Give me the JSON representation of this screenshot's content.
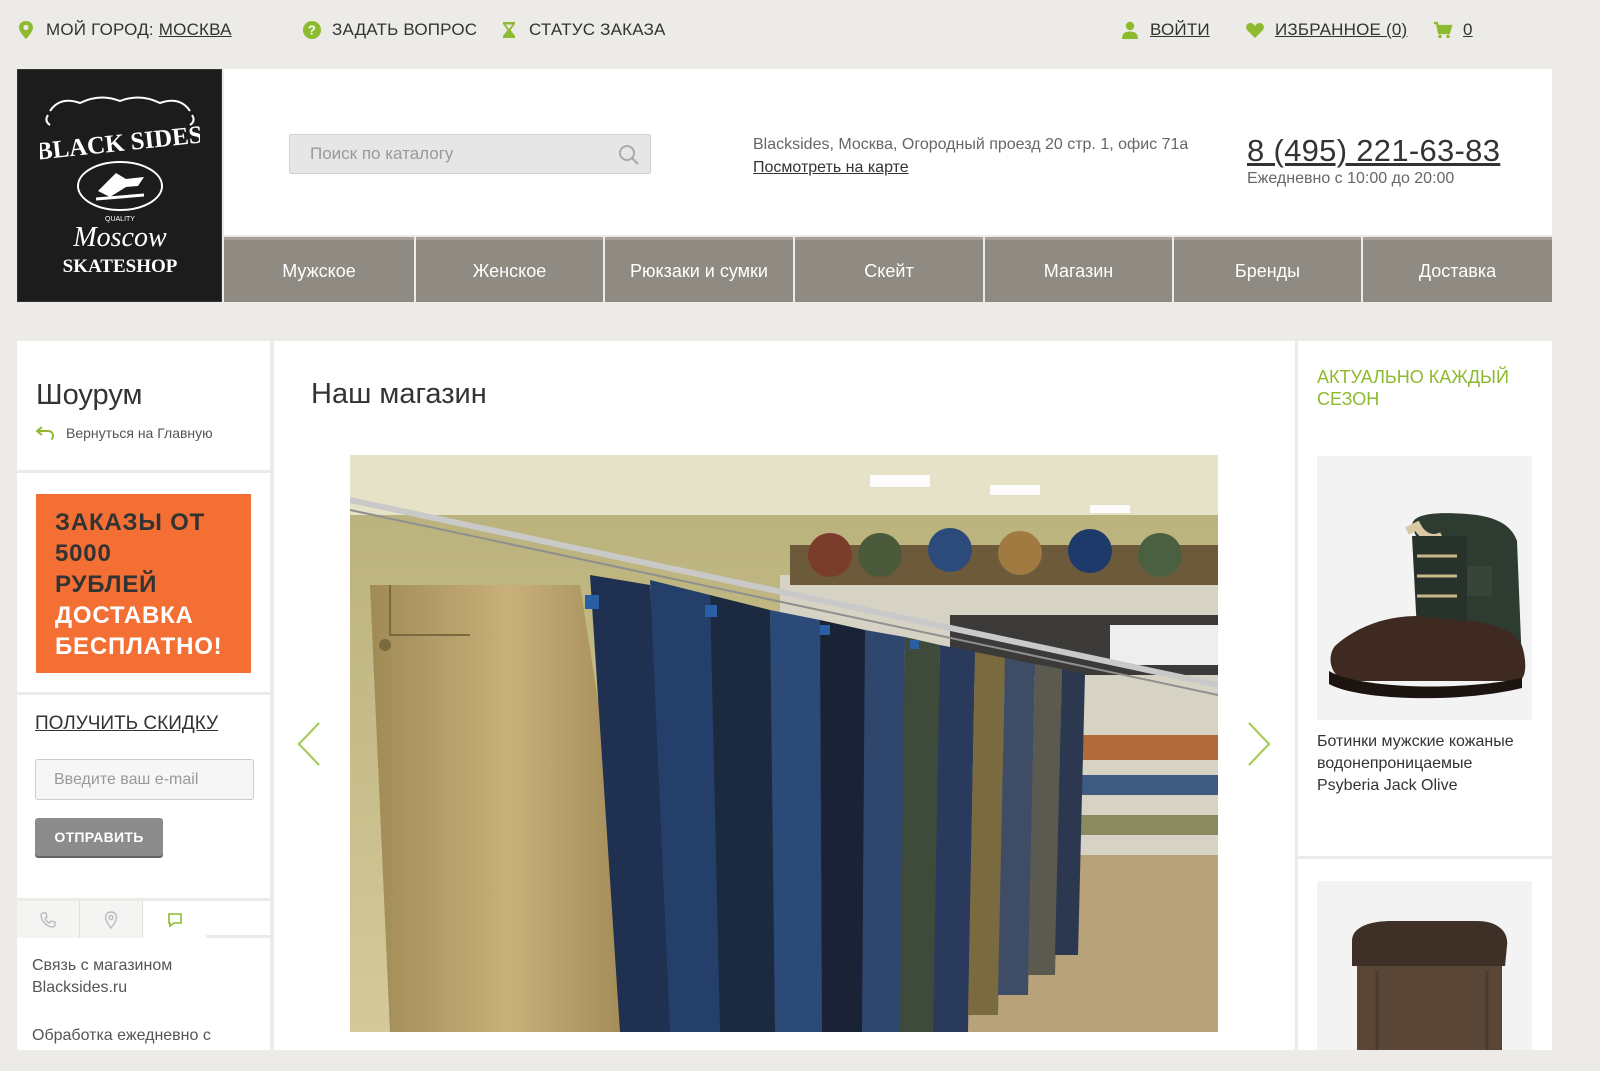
{
  "topbar": {
    "city_label": "МОЙ ГОРОД:",
    "city_value": "МОСКВА",
    "ask": "ЗАДАТЬ ВОПРОС",
    "status": "СТАТУС ЗАКАЗА",
    "login": "ВОЙТИ",
    "favorites": "ИЗБРАННОЕ (0)",
    "cart_count": "0",
    "icons": [
      "map-pin-icon",
      "question-icon",
      "hourglass-icon",
      "user-icon",
      "heart-icon",
      "cart-icon"
    ],
    "icon_color": "#8dba2e"
  },
  "logo": {
    "line1": "BLACK SIDES",
    "line2": "QUALITY",
    "line3": "Moscow",
    "line4": "SKATESHOP"
  },
  "header": {
    "search_placeholder": "Поиск по каталогу",
    "address_text": "Blacksides, Москва, Огородный проезд 20 стр. 1, офис 71а",
    "map_link": "Посмотреть на карте",
    "phone": "8 (495) 221-63-83",
    "hours": "Ежедневно с 10:00 до 20:00"
  },
  "nav": [
    {
      "label": "Мужское"
    },
    {
      "label": "Женское"
    },
    {
      "label": "Рюкзаки и сумки"
    },
    {
      "label": "Скейт"
    },
    {
      "label": "Магазин"
    },
    {
      "label": "Бренды"
    },
    {
      "label": "Доставка"
    }
  ],
  "sidebar": {
    "title": "Шоурум",
    "back_link": "Вернуться на Главную",
    "promo_lines": [
      "ЗАКАЗЫ ОТ",
      "5000",
      "РУБЛЕЙ",
      "ДОСТАВКА",
      "БЕСПЛАТНО!"
    ],
    "promo_color": "#f36f34",
    "discount_link": "ПОЛУЧИТЬ СКИДКУ",
    "email_placeholder": "Введите ваш e-mail",
    "send_button": "ОТПРАВИТЬ",
    "tabs": [
      "phone-icon",
      "map-pin-icon",
      "chat-icon"
    ],
    "contact_text": "Связь с магазином Blacksides.ru",
    "contact_text2": "Обработка ежедневно с"
  },
  "main": {
    "title": "Наш магазин"
  },
  "right": {
    "title": "АКТУАЛЬНО КАЖДЫЙ СЕЗОН",
    "title_color": "#8dba2e",
    "product1_name": "Ботинки мужские кожаные водонепроницаемые Psyberia Jack Olive"
  }
}
